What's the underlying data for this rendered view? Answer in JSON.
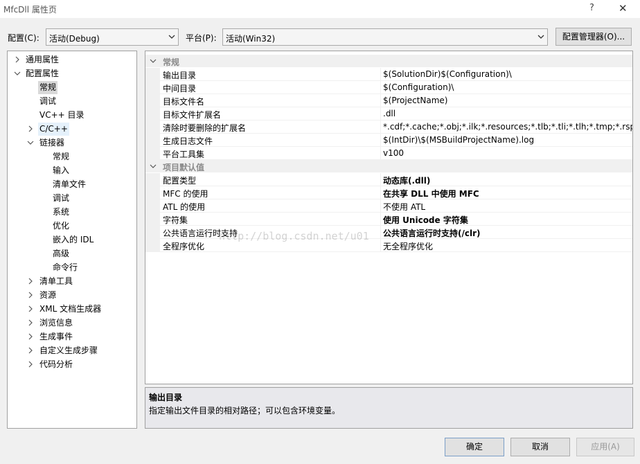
{
  "window": {
    "title": "MfcDll 属性页",
    "help": "?",
    "close": "✕"
  },
  "config": {
    "label": "配置(C):",
    "value": "活动(Debug)"
  },
  "platform": {
    "label": "平台(P):",
    "value": "活动(Win32)"
  },
  "buttons": {
    "config_manager": "配置管理器(O)...",
    "ok": "确定",
    "cancel": "取消",
    "apply": "应用(A)"
  },
  "tree": [
    {
      "label": "通用属性",
      "expander": "collapsed",
      "state": ""
    },
    {
      "label": "配置属性",
      "expander": "expanded",
      "state": ""
    },
    {
      "label": "常规",
      "expander": "none",
      "state": "selected"
    },
    {
      "label": "调试",
      "expander": "none",
      "state": ""
    },
    {
      "label": "VC++ 目录",
      "expander": "none",
      "state": ""
    },
    {
      "label": "C/C++",
      "expander": "collapsed",
      "state": "hover"
    },
    {
      "label": "链接器",
      "expander": "expanded",
      "state": ""
    },
    {
      "label": "常规",
      "expander": "none",
      "state": ""
    },
    {
      "label": "输入",
      "expander": "none",
      "state": ""
    },
    {
      "label": "清单文件",
      "expander": "none",
      "state": ""
    },
    {
      "label": "调试",
      "expander": "none",
      "state": ""
    },
    {
      "label": "系统",
      "expander": "none",
      "state": ""
    },
    {
      "label": "优化",
      "expander": "none",
      "state": ""
    },
    {
      "label": "嵌入的 IDL",
      "expander": "none",
      "state": ""
    },
    {
      "label": "高级",
      "expander": "none",
      "state": ""
    },
    {
      "label": "命令行",
      "expander": "none",
      "state": ""
    },
    {
      "label": "清单工具",
      "expander": "collapsed",
      "state": ""
    },
    {
      "label": "资源",
      "expander": "collapsed",
      "state": ""
    },
    {
      "label": "XML 文档生成器",
      "expander": "collapsed",
      "state": ""
    },
    {
      "label": "浏览信息",
      "expander": "collapsed",
      "state": ""
    },
    {
      "label": "生成事件",
      "expander": "collapsed",
      "state": ""
    },
    {
      "label": "自定义生成步骤",
      "expander": "collapsed",
      "state": ""
    },
    {
      "label": "代码分析",
      "expander": "collapsed",
      "state": ""
    }
  ],
  "grid": {
    "categories": [
      {
        "label": "常规",
        "rows": [
          {
            "name": "输出目录",
            "value": "$(SolutionDir)$(Configuration)\\",
            "bold": false
          },
          {
            "name": "中间目录",
            "value": "$(Configuration)\\",
            "bold": false
          },
          {
            "name": "目标文件名",
            "value": "$(ProjectName)",
            "bold": false
          },
          {
            "name": "目标文件扩展名",
            "value": ".dll",
            "bold": false
          },
          {
            "name": "清除时要删除的扩展名",
            "value": "*.cdf;*.cache;*.obj;*.ilk;*.resources;*.tlb;*.tli;*.tlh;*.tmp;*.rsp;*.pgc",
            "bold": false
          },
          {
            "name": "生成日志文件",
            "value": "$(IntDir)\\$(MSBuildProjectName).log",
            "bold": false
          },
          {
            "name": "平台工具集",
            "value": "v100",
            "bold": false
          }
        ]
      },
      {
        "label": "项目默认值",
        "rows": [
          {
            "name": "配置类型",
            "value": "动态库(.dll)",
            "bold": true
          },
          {
            "name": "MFC 的使用",
            "value": "在共享 DLL 中使用 MFC",
            "bold": true
          },
          {
            "name": "ATL 的使用",
            "value": "不使用 ATL",
            "bold": false
          },
          {
            "name": "字符集",
            "value": "使用 Unicode 字符集",
            "bold": true
          },
          {
            "name": "公共语言运行时支持",
            "value": "公共语言运行时支持(/clr)",
            "bold": true
          },
          {
            "name": "全程序优化",
            "value": "无全程序优化",
            "bold": false
          }
        ]
      }
    ],
    "watermark": "http://blog.csdn.net/u01"
  },
  "description": {
    "title": "输出目录",
    "text": "指定输出文件目录的相对路径；可以包含环境变量。"
  },
  "colors": {
    "selected": "#d9d9d9",
    "hover": "#e5f1fb",
    "category_text": "#8a8a8a"
  }
}
